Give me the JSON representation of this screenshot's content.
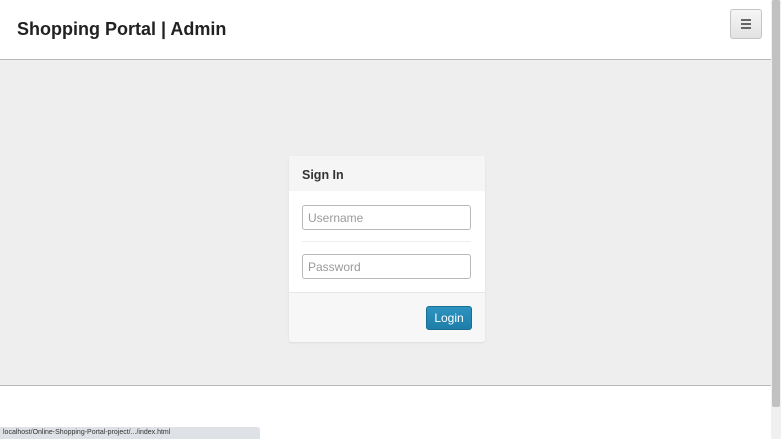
{
  "header": {
    "brand": "Shopping Portal | Admin",
    "menu_icon": "hamburger-menu-icon"
  },
  "login": {
    "title": "Sign In",
    "username_placeholder": "Username",
    "username_value": "",
    "password_placeholder": "Password",
    "password_value": "",
    "submit_label": "Login"
  },
  "status_bar": {
    "url": "localhost/Online-Shopping-Portal-project/.../index.html"
  },
  "colors": {
    "page_background": "#eeeeee",
    "header_background": "#ffffff",
    "primary_button": "#2389b5"
  }
}
